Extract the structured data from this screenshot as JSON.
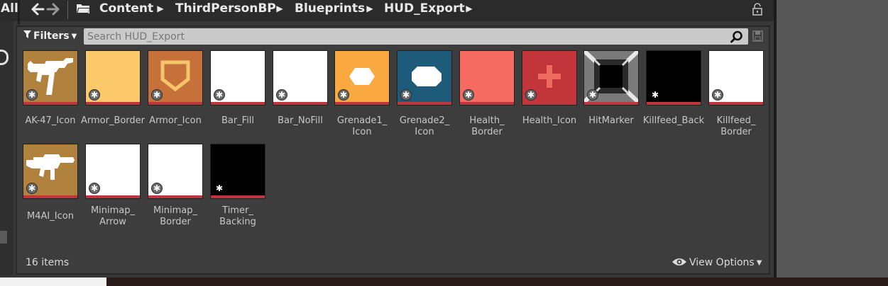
{
  "breadcrumb": {
    "all_label": "All",
    "back": "arrow-left-icon",
    "forward": "arrow-right-icon",
    "items": [
      {
        "label": "Content"
      },
      {
        "label": "ThirdPersonBP"
      },
      {
        "label": "Blueprints"
      },
      {
        "label": "HUD_Export"
      }
    ],
    "separator": "›"
  },
  "toolbar": {
    "filters_label": "Filters",
    "search_placeholder": "Search HUD_Export"
  },
  "assets": [
    {
      "label": "AK-47_Icon",
      "bg": "#b0823e",
      "art": "rifle-ak"
    },
    {
      "label": "Armor_Border",
      "bg": "#fcc96a",
      "art": "solid"
    },
    {
      "label": "Armor_Icon",
      "bg": "#c7713a",
      "art": "shield"
    },
    {
      "label": "Bar_Fill",
      "bg": "#ffffff",
      "art": "solid"
    },
    {
      "label": "Bar_NoFill",
      "bg": "#ffffff",
      "art": "solid"
    },
    {
      "label": "Grenade1_\nIcon",
      "bg": "#f9a93f",
      "art": "grenade1"
    },
    {
      "label": "Grenade2_\nIcon",
      "bg": "#1e5a7a",
      "art": "grenade2"
    },
    {
      "label": "Health_\nBorder",
      "bg": "#f56b61",
      "art": "solid"
    },
    {
      "label": "Health_Icon",
      "bg": "#c2353b",
      "art": "cross"
    },
    {
      "label": "HitMarker",
      "bg": "#8f8f8f",
      "art": "hitmarker"
    },
    {
      "label": "Killfeed_Back",
      "bg": "#000000",
      "art": "solid"
    },
    {
      "label": "Killfeed_\nBorder",
      "bg": "#ffffff",
      "art": "solid"
    },
    {
      "label": "M4AI_Icon",
      "bg": "#b0823e",
      "art": "rifle-m4"
    },
    {
      "label": "Minimap_\nArrow",
      "bg": "#ffffff",
      "art": "solid"
    },
    {
      "label": "Minimap_\nBorder",
      "bg": "#ffffff",
      "art": "solid"
    },
    {
      "label": "Timer_\nBacking",
      "bg": "#000000",
      "art": "solid"
    }
  ],
  "status": {
    "item_count": "16 items",
    "view_options_label": "View Options"
  },
  "icons": {
    "folder": "folder-icon",
    "lock": "lock-icon",
    "search": "search-icon",
    "save": "save-search-icon",
    "eye": "eye-icon",
    "badge": "texture-asset-icon"
  },
  "colors": {
    "panel_bg": "#3d3d3d",
    "topbar_bg": "#2b2b2b",
    "asset_bar": "#c0343d",
    "search_bg": "#cacaca"
  }
}
